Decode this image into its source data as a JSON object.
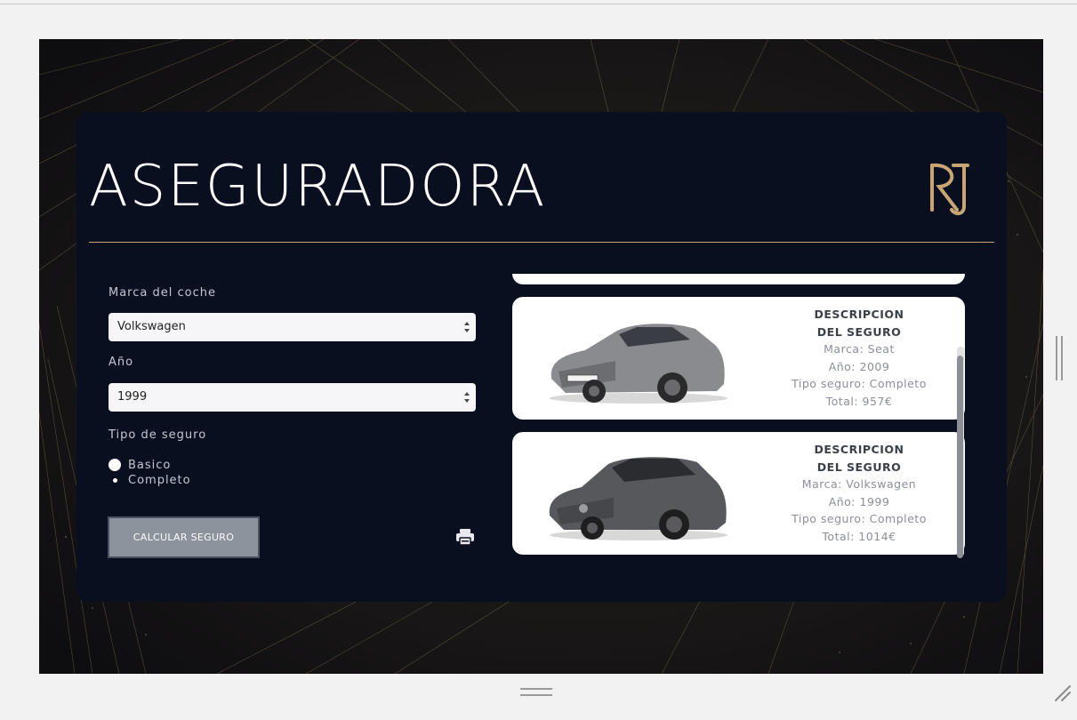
{
  "header": {
    "title": "ASEGURADORA",
    "logo_icon": "rj-monogram-logo"
  },
  "form": {
    "brand": {
      "label": "Marca del coche",
      "selected": "Volkswagen"
    },
    "year": {
      "label": "Año",
      "selected": "1999"
    },
    "insurance_type": {
      "label": "Tipo de seguro",
      "options": [
        {
          "label": "Basico",
          "checked": false
        },
        {
          "label": "Completo",
          "checked": true
        }
      ]
    },
    "submit_label": "CALCULAR SEGURO",
    "print_icon": "printer-icon"
  },
  "results": [
    {
      "heading_1": "DESCRIPCION",
      "heading_2": "DEL SEGURO",
      "brand": "Marca: Seat",
      "year": "Año: 2009",
      "type": "Tipo seguro: Completo",
      "total": "Total: 957€"
    },
    {
      "heading_1": "DESCRIPCION",
      "heading_2": "DEL SEGURO",
      "brand": "Marca: Volkswagen",
      "year": "Año: 1999",
      "type": "Tipo seguro: Completo",
      "total": "Total: 1014€"
    }
  ],
  "colors": {
    "card_background": "#0a0f1f",
    "accent_gold": "#c9a574",
    "button_gray": "#8c939d"
  }
}
